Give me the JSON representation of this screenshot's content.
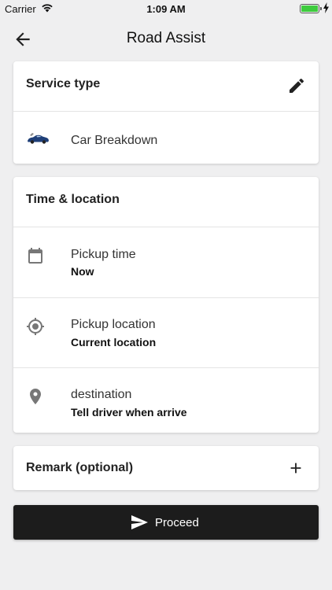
{
  "status_bar": {
    "carrier": "Carrier",
    "time": "1:09 AM",
    "battery_color": "#3ecb3e"
  },
  "nav": {
    "title": "Road Assist",
    "back_icon": "arrow-back-icon"
  },
  "service_card": {
    "title": "Service type",
    "edit_icon": "pencil-icon",
    "item": {
      "icon": "car-icon",
      "label": "Car Breakdown"
    }
  },
  "time_location_card": {
    "title": "Time & location",
    "rows": [
      {
        "icon": "calendar-icon",
        "label": "Pickup time",
        "value": "Now"
      },
      {
        "icon": "crosshair-location-icon",
        "label": "Pickup location",
        "value": "Current location"
      },
      {
        "icon": "map-pin-icon",
        "label": "destination",
        "value": "Tell driver when arrive"
      }
    ]
  },
  "remark_card": {
    "title": "Remark (optional)",
    "add_icon": "plus-icon"
  },
  "proceed_button": {
    "label": "Proceed",
    "icon": "send-icon",
    "background": "#1c1c1c"
  }
}
